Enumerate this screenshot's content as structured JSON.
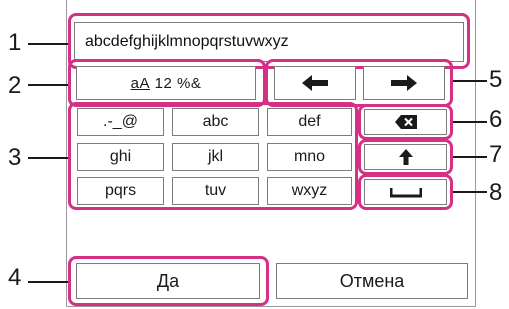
{
  "text_input": {
    "value": "abcdefghijklmnopqrstuvwxyz"
  },
  "mode_key": {
    "label_underlined": "aA",
    "label_rest": " 12 %&"
  },
  "keys": {
    "row1": [
      ".-_@",
      "abc",
      "def"
    ],
    "row2": [
      "ghi",
      "jkl",
      "mno"
    ],
    "row3": [
      "pqrs",
      "tuv",
      "wxyz"
    ]
  },
  "actions": {
    "ok_label": "Да",
    "cancel_label": "Отмена"
  },
  "callouts": [
    "1",
    "2",
    "3",
    "4",
    "5",
    "6",
    "7",
    "8"
  ],
  "icons": {
    "cursor_left": "arrow-left-icon",
    "cursor_right": "arrow-right-icon",
    "backspace": "backspace-icon",
    "shift": "arrow-up-icon",
    "space": "space-icon"
  },
  "colors": {
    "highlight": "#d62f86"
  }
}
